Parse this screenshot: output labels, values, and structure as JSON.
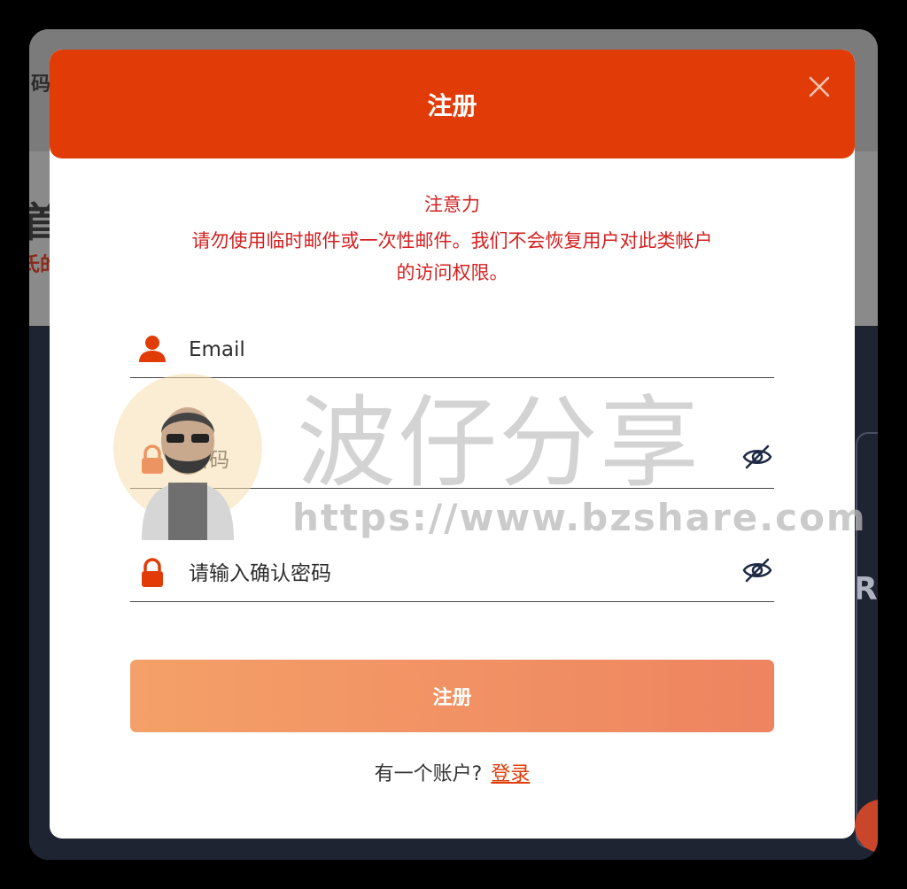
{
  "background": {
    "fragment_top": "码",
    "fragment_mid": "首",
    "fragment_red": "氏的",
    "fragment_right": "R"
  },
  "modal": {
    "title": "注册",
    "notice": {
      "title": "注意力",
      "line1": "请勿使用临时邮件或一次性邮件。我们不会恢复用户对此类帐户",
      "line2": "的访问权限。"
    },
    "fields": {
      "email_placeholder": "Email",
      "password_placeholder": "密码",
      "confirm_placeholder": "请输入确认密码"
    },
    "submit_label": "注册",
    "login_prompt": "有一个账户?",
    "login_link": "登录"
  },
  "watermark": {
    "chars": "波仔分享",
    "url": "https://www.bzshare.com"
  },
  "colors": {
    "accent": "#e13c07",
    "notice": "#d32020",
    "button_start": "#f4a068",
    "button_end": "#ee8460"
  },
  "icons": [
    "close-icon",
    "user-icon",
    "lock-icon",
    "eye-off-icon"
  ]
}
